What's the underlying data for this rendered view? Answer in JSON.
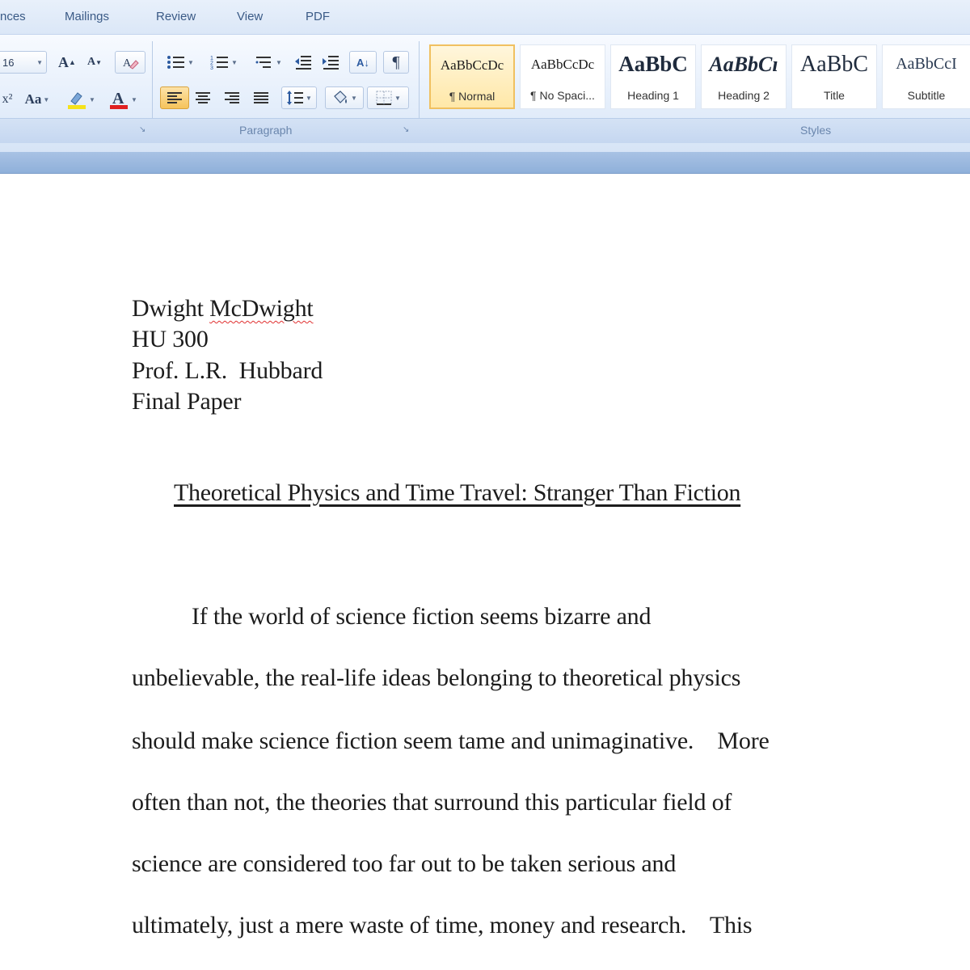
{
  "ribbon": {
    "tabs": [
      "nces",
      "Mailings",
      "Review",
      "View",
      "PDF"
    ],
    "font": {
      "size_value": "16",
      "grow_label": "A",
      "shrink_label": "A",
      "case_label": "Aa",
      "font_color_label": "A"
    },
    "paragraph": {
      "group_label": "Paragraph",
      "sort_label": "A↓",
      "pilcrow_label": "¶"
    },
    "styles": {
      "group_label": "Styles",
      "items": [
        {
          "sample": "AaBbCcDc",
          "name": "¶ Normal",
          "selected": true
        },
        {
          "sample": "AaBbCcDc",
          "name": "¶ No Spaci...",
          "selected": false
        },
        {
          "sample": "AaBbC",
          "name": "Heading 1",
          "selected": false
        },
        {
          "sample": "AaBbCı",
          "name": "Heading 2",
          "selected": false
        },
        {
          "sample": "AaBbC",
          "name": "Title",
          "selected": false
        },
        {
          "sample": "AaBbCcI",
          "name": "Subtitle",
          "selected": false
        }
      ]
    },
    "colors": {
      "highlight": "#f5e21b",
      "font_color": "#e02020"
    }
  },
  "document": {
    "header_lines": {
      "name_first": "Dwight",
      "name_last": "McDwight",
      "course": "HU 300",
      "professor": "Prof. L.R.  Hubbard",
      "assignment": "Final Paper"
    },
    "title": "Theoretical Physics and Time Travel: Stranger Than Fiction",
    "body_lines": [
      "If the world of science fiction seems bizarre and",
      "unbelievable, the real-life ideas belonging to theoretical physics",
      "should make science fiction seem tame and unimaginative.    More",
      "often than not, the theories that surround this particular field of",
      "science are considered too far out to be taken serious and",
      "ultimately, just a mere waste of time, money and research.    This"
    ]
  }
}
